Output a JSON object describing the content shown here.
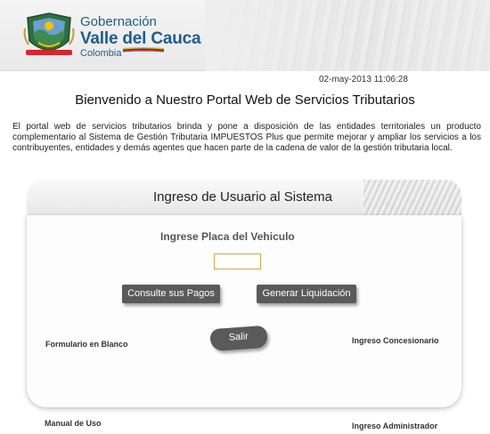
{
  "header": {
    "brand_line1": "Gobernación",
    "brand_line2": "Valle del Cauca",
    "brand_line3": "Colombia",
    "flag_colors": [
      "#f2c300",
      "#1a3f9b",
      "#d7262e"
    ]
  },
  "datetime": "02-may-2013 11:06:28",
  "welcome_title": "Bienvenido a Nuestro Portal Web de Servicios Tributarios",
  "intro_text": "El portal web de servicios tributarios brinda y pone a disposición de las entidades territoriales un producto complementario al Sistema de Gestión Tributaria IMPUESTOS Plus que permite mejorar y ampliar los servicios a los contribuyentes, entidades y demás agentes que hacen parte de la cadena de valor de la gestión tributaria local.",
  "login_card": {
    "title": "Ingreso de Usuario al Sistema",
    "plate_label": "Ingrese Placa del Vehiculo",
    "plate_value": "",
    "button_pagos": "Consulte sus Pagos",
    "button_liquidacion": "Generar Liquidación",
    "button_salir": "Salir"
  },
  "links": {
    "formulario": "Formulario en Blanco",
    "concesionario": "Ingreso Concesionario",
    "manual": "Manual de Uso",
    "administrador": "Ingreso Administrador"
  },
  "colors": {
    "brand_blue": "#1e5e8c",
    "button_gray": "#5a5a5a",
    "input_border": "#d9a74a"
  }
}
